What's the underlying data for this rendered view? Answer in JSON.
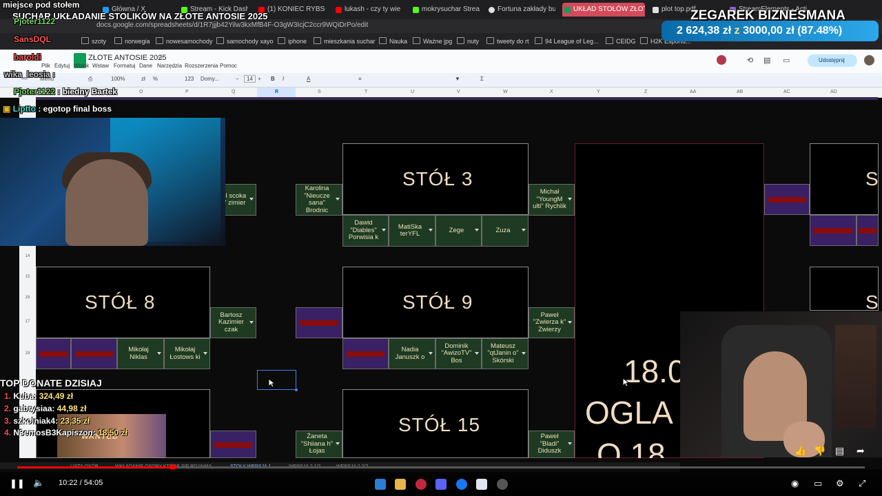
{
  "browser": {
    "tabs": [
      {
        "label": "Główna / X",
        "color": "#1d9bf0"
      },
      {
        "label": "Stream - Kick Dashbo",
        "color": "#53fc18"
      },
      {
        "label": "(1) KONIEC RYBSON",
        "color": "#ff0000"
      },
      {
        "label": "lukash - czy ty wie",
        "color": "#ff0000"
      },
      {
        "label": "mokrysuchar Stream",
        "color": "#53fc18"
      },
      {
        "label": "Fortuna zakłady bukm",
        "color": "#e0e0e0"
      },
      {
        "label": "UKŁAD STOŁÓW ZŁOTE A",
        "color": "#0f9d58"
      },
      {
        "label": "plot top.pdf",
        "color": "#e0e0e0"
      },
      {
        "label": "StreamElements - Acti",
        "color": "#8a63d2"
      }
    ],
    "url": "docs.google.com/spreadsheets/d/1R7jjjb42Yilw3kxMfB4F-O3gW3IcjC2ccr9WQiDrPo/edit",
    "bookmarks": [
      "szoty",
      "norwegia",
      "nowesamochody",
      "samochody xayo",
      "iphone",
      "mieszkania suchar",
      "Nauka",
      "Ważne jpg",
      "nuty",
      "tweety do rt",
      "94 League of Leg...",
      "CEIDG",
      "H2K Esportu..."
    ]
  },
  "sheets": {
    "title": "ZŁOTE ANTOSIE 2025",
    "menu": [
      "Plik",
      "Edytuj",
      "Widok",
      "Wstaw",
      "Formatuj",
      "Dane",
      "Narzędzia",
      "Rozszerzenia",
      "Pomoc"
    ],
    "toolbar": {
      "zoom": "100%",
      "font": "Domy...",
      "font_size": "14",
      "menu_label": "Menu",
      "currency": "zł",
      "percent": "%",
      "num123": "123"
    },
    "share_label": "Udostępnij",
    "columns": [
      "O",
      "P",
      "Q",
      "R",
      "S",
      "T",
      "U",
      "V",
      "W",
      "X",
      "Y",
      "Z",
      "AA",
      "AB",
      "AC",
      "AD"
    ],
    "rows": [
      "14",
      "15",
      "16",
      "17",
      "18"
    ],
    "tables": [
      {
        "name": "STÓŁ 3"
      },
      {
        "name": "STÓŁ 8"
      },
      {
        "name": "STÓŁ 9"
      },
      {
        "name": "STÓŁ 15"
      }
    ],
    "guests": {
      "karolina": "Karolina \"Nieucze sana\" Brodnic",
      "michal": "Michał \"YoungM ulti\" Rychlik",
      "dawid": "Dawid \"Diables\" Porwisia k",
      "matiska": "MatiSka terYFL",
      "zege": "Zege",
      "zuza": "Zuza",
      "karol_partial": "arol scoka rol\" zimier",
      "bartosz": "Bartosz Kazimier czak",
      "pawel_z": "Paweł \"Zwierza k\" Zwierzy",
      "mikolaj_n": "Mikołaj Niklas",
      "mikolaj_l": "Mikołaj Łostows ki",
      "nadia": "Nadia Januszk o",
      "dominik": "Dominik \"AwizoTV\" Bos",
      "mateusz": "Mateusz \"qtJanin o\" Skórski",
      "zaneta": "Żaneta \"Shiiana h\" Łojas",
      "pawel_b": "Paweł \"Bladi\" Diduszk"
    },
    "announce": {
      "line1": "18.0",
      "line2": "OGLA",
      "line3": "O 18"
    },
    "sheet_tabs": [
      "LISTA OSÓB",
      "WKŁADANIE OSOBY KTÓRE SIĘ POJAWIĄ",
      "STOŁY WERSJA 1",
      "WERSJA 2 1/2",
      "WERSJA 2 2/2"
    ]
  },
  "stream": {
    "title": "SUCHAR UKŁADANIE STOLIKÓW NA ZŁOTE ANTOSIE 2025",
    "place_label": "miejsce pod stołem",
    "goal": {
      "name": "ZEGAREK BIZNESMANA",
      "current": "2 624,38 zł",
      "sep": "z",
      "target": "3000,00 zł",
      "percent": "(87.48%)"
    },
    "chat": [
      {
        "user": "Pjoter1122",
        "text": "",
        "color": "#7bd66b"
      },
      {
        "user": "SansDQL",
        "text": "",
        "color": "#ff5a5a"
      },
      {
        "user": "baroldi",
        "text": "",
        "color": "#ff5a5a"
      },
      {
        "user": "wika_leosia",
        "text": ":",
        "color": "#c8c8c8"
      },
      {
        "user": "Pjoter1122",
        "text": ": biedny Bartek",
        "color": "#7bd66b"
      },
      {
        "user": "Liptto",
        "text": ": egotop final boss",
        "color": "#4cd7c2"
      }
    ],
    "donate_header": "TOP DONATE DZISIAJ",
    "donors": [
      {
        "rank": "1.",
        "name": "Kuba",
        "amount": "324,49 zł"
      },
      {
        "rank": "2.",
        "name": "gabrysiaa",
        "amount": "44,98 zł"
      },
      {
        "rank": "3.",
        "name": "szkolniak4",
        "amount": "23,35 zł"
      },
      {
        "rank": "4.",
        "name": "N3emosB3Kapiszon",
        "amount": "18,50 zł"
      }
    ],
    "wanted": "WANTED"
  },
  "player": {
    "time": "10:22 / 54:05",
    "progress": 0.189
  },
  "colors": {
    "table_text": "#f0dcc1",
    "guest_bg": "#1e3a22",
    "empty_bg": "#3a2064",
    "red_bar": "#8a0c0c"
  }
}
